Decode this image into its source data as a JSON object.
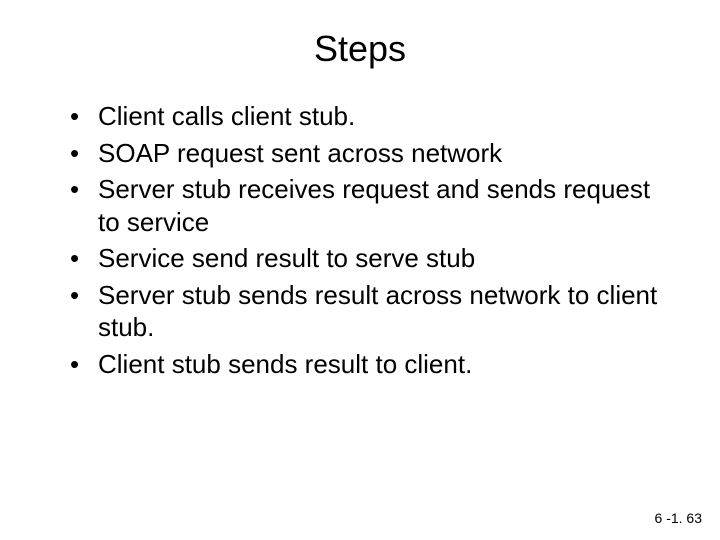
{
  "title": "Steps",
  "bullets": [
    "Client calls client stub.",
    "SOAP request sent across network",
    "Server stub receives request and sends request  to service",
    "Service send result to serve stub",
    "Server stub sends result across network to client stub.",
    "Client stub sends result to client."
  ],
  "footer": "6 -1. 63"
}
